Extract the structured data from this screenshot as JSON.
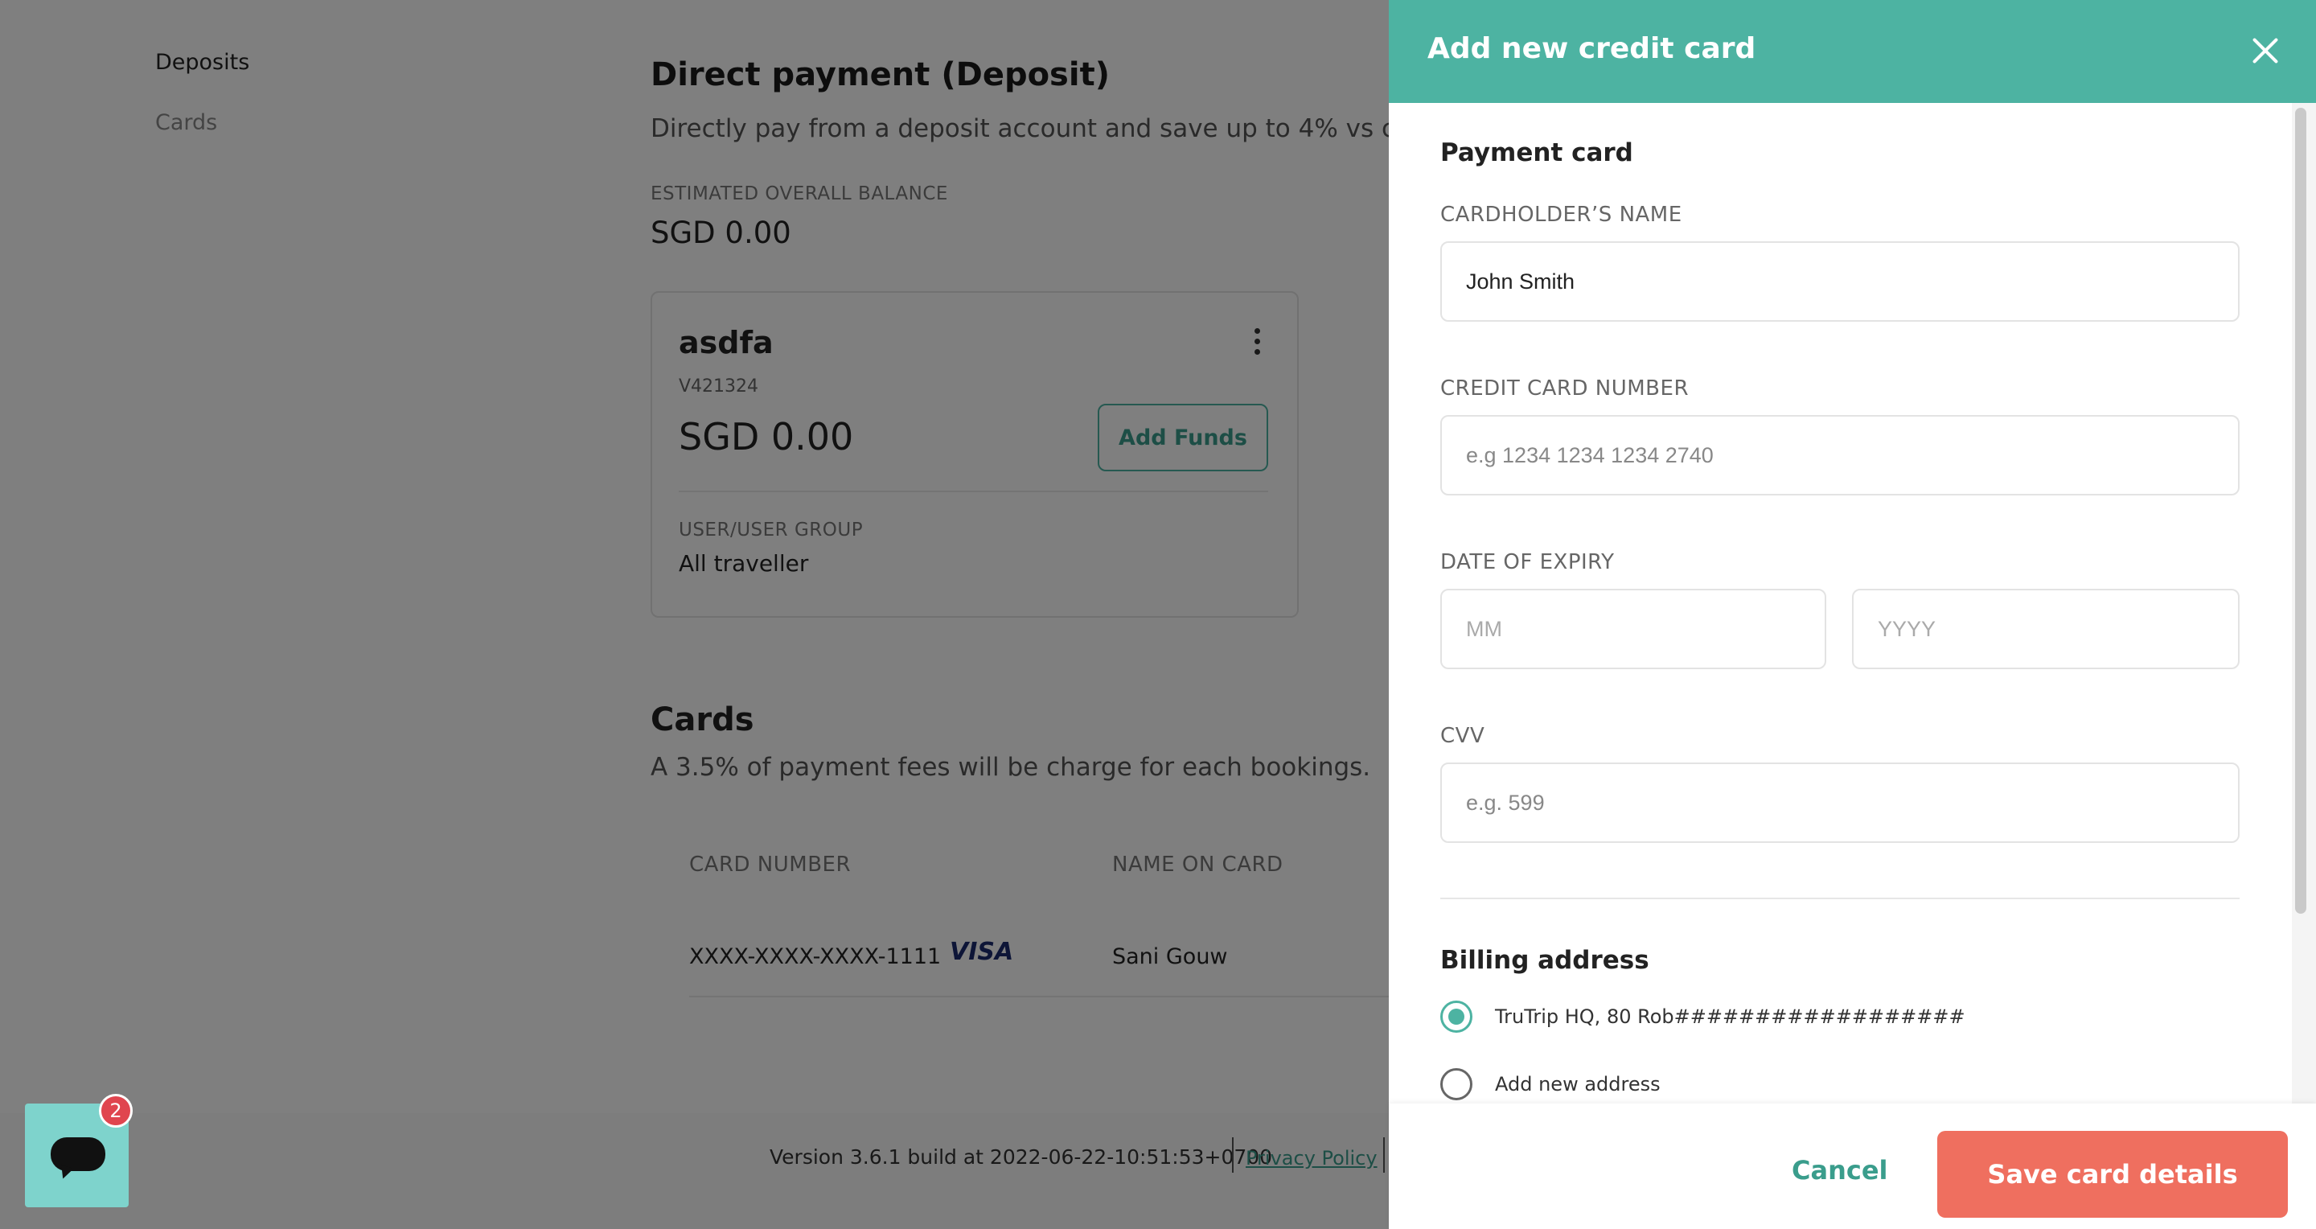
{
  "side_nav": {
    "items": [
      {
        "label": "Deposits"
      },
      {
        "label": "Cards"
      }
    ]
  },
  "deposit_section": {
    "title": "Direct payment (Deposit)",
    "description": "Directly pay from a deposit account and save up to 4% vs c",
    "balance_label": "ESTIMATED OVERALL BALANCE",
    "balance_value": "SGD 0.00"
  },
  "deposit_card": {
    "name": "asdfa",
    "code": "V421324",
    "amount": "SGD 0.00",
    "add_funds_label": "Add Funds",
    "group_label": "USER/USER GROUP",
    "group_value": "All traveller"
  },
  "cards_section": {
    "title": "Cards",
    "description": "A 3.5% of payment fees will be charge for each bookings.",
    "columns": [
      "CARD NUMBER",
      "NAME ON CARD"
    ],
    "rows": [
      {
        "card_number": "XXXX-XXXX-XXXX-1111",
        "brand": "VISA",
        "name_on_card": "Sani Gouw"
      }
    ]
  },
  "footer": {
    "version": "Version 3.6.1 build at 2022-06-22-10:51:53+0700",
    "privacy_policy": "Privacy Policy"
  },
  "chat": {
    "badge_count": "2"
  },
  "drawer": {
    "title": "Add new credit card",
    "payment_heading": "Payment card",
    "cardholder_label": "CARDHOLDER’S NAME",
    "cardholder_value": "John Smith",
    "card_number_label": "CREDIT CARD NUMBER",
    "card_number_placeholder": "e.g 1234 1234 1234 2740",
    "expiry_label": "DATE OF EXPIRY",
    "expiry_month_placeholder": "MM",
    "expiry_year_placeholder": "YYYY",
    "cvv_label": "CVV",
    "cvv_placeholder": "e.g. 599",
    "billing_heading": "Billing address",
    "address_options": [
      {
        "label": "TruTrip HQ, 80 Rob##################",
        "checked": true
      },
      {
        "label": "Add new address",
        "checked": false
      }
    ],
    "cancel_label": "Cancel",
    "save_label": "Save card details"
  },
  "colors": {
    "accent": "#4db3a2",
    "save_button": "#ef6f5f",
    "badge": "#e0454f",
    "chat": "#7ed3cc"
  }
}
